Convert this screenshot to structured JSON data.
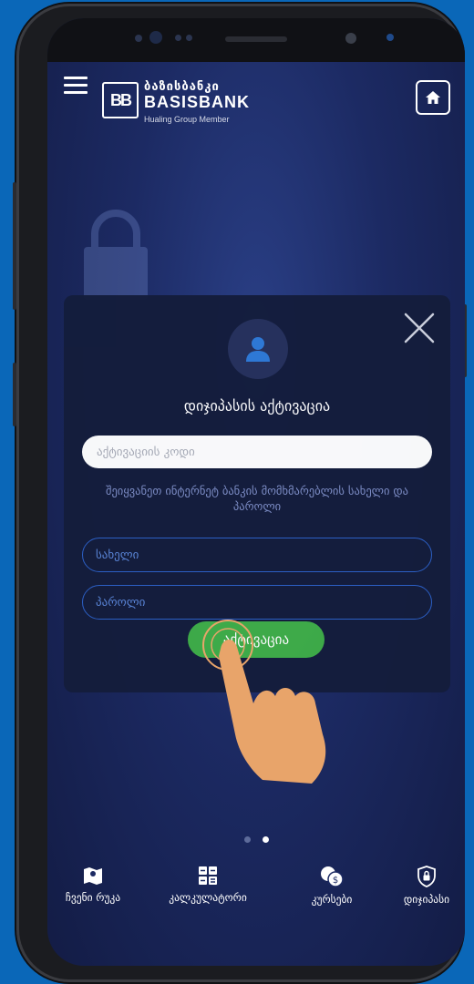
{
  "header": {
    "logo_mark": "BB",
    "logo_georgian": "ბაზისბანკი",
    "logo_english": "BASISBANK",
    "logo_subtitle": "Hualing Group Member"
  },
  "modal": {
    "title": "დიჯიპასის აქტივაცია",
    "code_placeholder": "აქტივაციის კოდი",
    "hint": "შეიყვანეთ ინტერნეტ ბანკის მომხმარებლის სახელი და პაროლი",
    "username_placeholder": "სახელი",
    "password_placeholder": "პაროლი",
    "activate_label": "აქტივაცია"
  },
  "pager": {
    "active_index": 1,
    "count": 2
  },
  "bottom_nav": [
    {
      "label": "ჩვენი რუკა",
      "icon": "map-icon"
    },
    {
      "label": "კალკულატორი",
      "icon": "calculator-icon"
    },
    {
      "label": "კურსები",
      "icon": "currency-icon"
    },
    {
      "label": "დიჯიპასი",
      "icon": "shield-lock-icon"
    }
  ],
  "colors": {
    "background": "#0a67b8",
    "screen_bg": "#1c2a63",
    "modal_bg": "#141d3c",
    "accent_green": "#3fae48",
    "field_border": "#2d61c8"
  }
}
